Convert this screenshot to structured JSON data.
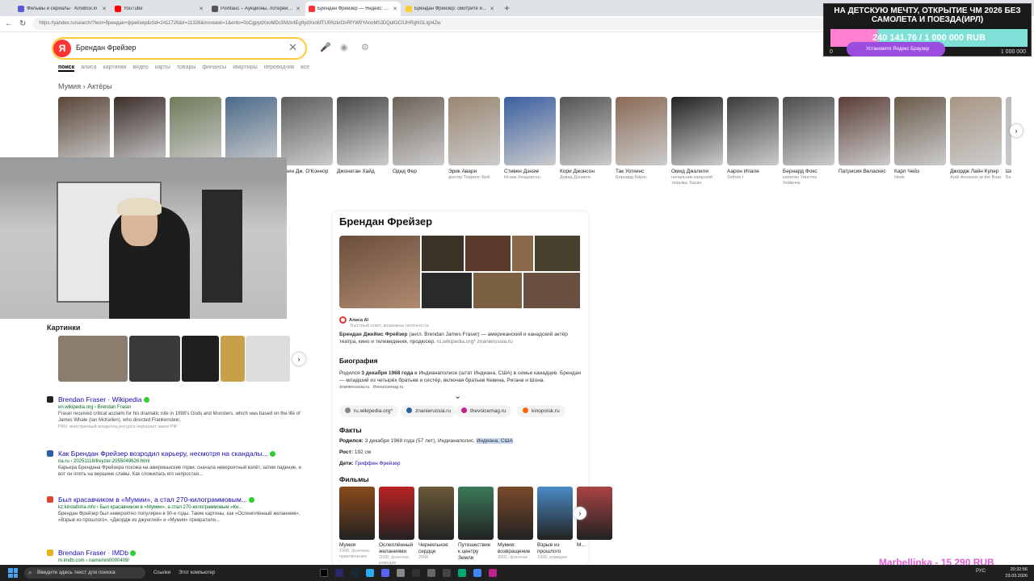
{
  "browser": {
    "tabs": [
      {
        "label": "Фильмы и сериалы · Kinobox.in",
        "color": "#5b5bd6"
      },
      {
        "label": "YouTube",
        "color": "#f00"
      },
      {
        "label": "Pointauc – Аукционы, лотереи и ...",
        "color": "#555"
      },
      {
        "label": "Брендан Фрейзер — Яндекс: нашлось ...",
        "color": "#f33"
      },
      {
        "label": "Брендан Фрейзер: смотрите и ск...",
        "color": "#fc3"
      }
    ],
    "new_tab": "+",
    "url": "https://yandex.ru/search/?text=брендан+фрейзер&clid=2411726&lr=11326&msreask=1&ento=0oCgpydXxoMDc5Mzk4Eg9ydXxoMTU0NzkrOnRlYW0YAnoM0JDQutGC0JHRgNGLIgI4Zw"
  },
  "overlay": {
    "title": "НА ДЕТСКУЮ МЕЧТУ, ОТКРЫТИЕ ЧМ 2026 БЕЗ САМОЛЕТА И ПОЕЗДА(ИРЛ)",
    "progress_text": "240 141.76 / 1 000 000 RUB",
    "progress_fraction": 0.24,
    "min": "0",
    "max": "1 000 000"
  },
  "search": {
    "logo": "Я",
    "query": "Брендан Фрейзер",
    "clear": "✕",
    "promo": "Установите Яндекс Браузер",
    "verticals": [
      "поиск",
      "алиса",
      "картинки",
      "видео",
      "карты",
      "товары",
      "финансы",
      "квартиры",
      "переводчик",
      "все"
    ]
  },
  "breadcrumb": "Мумия › Актёры",
  "actors": [
    {
      "name": "",
      "role": "",
      "color": "#5a4638"
    },
    {
      "name": "",
      "role": "",
      "color": "#3c2e2a"
    },
    {
      "name": "",
      "role": "",
      "color": "#6f7c5a"
    },
    {
      "name": "",
      "role": "",
      "color": "#4b6b8a"
    },
    {
      "name": "...вин Дж. О'Коннор",
      "role": "",
      "color": "#5d5d5d"
    },
    {
      "name": "Джонатан Хайд",
      "role": "",
      "color": "#4a4a4a"
    },
    {
      "name": "Одед Фер",
      "role": "",
      "color": "#6d6258"
    },
    {
      "name": "Эрик Авари",
      "role": "доктор Терренс Бей",
      "color": "#9a8670"
    },
    {
      "name": "Стивен Дэнэм",
      "role": "Исаак Хендерсон",
      "color": "#3a5fa0"
    },
    {
      "name": "Кори Джонсон",
      "role": "Дэвид Дэниелс",
      "color": "#555"
    },
    {
      "name": "Так Уоткинс",
      "role": "Бернард Бёрнс",
      "color": "#8a6a55"
    },
    {
      "name": "Омид Джалили",
      "role": "начальник каирской тюрьмы Хасан",
      "color": "#222"
    },
    {
      "name": "Аарон Ипале",
      "role": "Sethos I",
      "color": "#3b3b3b"
    },
    {
      "name": "Бернард Фокс",
      "role": "капитан Уинстон Хейвлок",
      "color": "#4d4d4d"
    },
    {
      "name": "Патрисия Веласкес",
      "role": "",
      "color": "#5a3d35"
    },
    {
      "name": "Карл Чейз",
      "role": "Hook",
      "color": "#6a5a4a"
    },
    {
      "name": "Джордж Лайн Купер",
      "role": "Arab Assassin at the Boat",
      "color": "#a89684"
    },
    {
      "name": "Шон Кур...",
      "role": "Бензо...",
      "color": "#bbb"
    }
  ],
  "images_block": {
    "title": "Картинки",
    "colors": [
      "#8a7d6e",
      "#3a3a3a",
      "#1e1e1e",
      "#c8a04a",
      "#ddd"
    ]
  },
  "results": [
    {
      "title": "Brendan Fraser · Wikipedia",
      "url": "en.wikipedia.org › Brendan Fraser",
      "snippet": "Fraser received critical acclaim for his dramatic role in 1998's Gods and Monsters, which was based on the life of James Whale (Ian McKellen), who directed Frankenstein.",
      "warn": "РКН: иностранный владелец ресурса нарушает закон РФ",
      "icon": "#222"
    },
    {
      "title": "Как Брендан Фрейзер возродил карьеру, несмотря на скандалы...",
      "url": "ria.ru › 20251116/freyzer-2055049626.html",
      "snippet": "Карьера Брендана Фрейзера похожа на американские горки: сначала невероятный взлёт, затем падение, и вот он опять на вершине славы. Как сложилась его непростая...",
      "warn": "",
      "icon": "#2a5fa8"
    },
    {
      "title": "Был красавчиком в «Мумии», а стал 270-килограммовым...",
      "url": "kz.kinoafisha.info › Был красавчиком в «Мумии», а стал 270-килограммовым «Ки...",
      "snippet": "Брендан Фрейзер был невероятно популярен в 90-е годы. Такие картины, как «Осленплённый желанием», «Взрыв из прошлого», «Джордж из джунглей» и «Мумия» превратили...",
      "warn": "",
      "icon": "#d43"
    },
    {
      "title": "Brendan Fraser · IMDb",
      "url": "m.imdb.com › name/nm0000409/",
      "snippet": "",
      "warn": "",
      "icon": "#e8b21a"
    }
  ],
  "knowledge": {
    "title": "Брендан Фрейзер",
    "photo_colors": [
      "#6a4e3c",
      "#3b3226",
      "#5a3a2a",
      "#8a6a4a",
      "#4a4030",
      "#2a2a2a",
      "#7a6040",
      "#6a5040"
    ],
    "alice": "Алиса AI",
    "alice_sub": "Быстрый ответ, возможны неточности",
    "desc_b": "Брендан Джеймс Фрейзер",
    "desc": " (англ. Brendan James Fraser) — американский и канадский актёр театра, кино и телевидения, продюсер.",
    "desc_src1": "ru.wikipedia.org*",
    "desc_src2": "znanierussia.ru",
    "bio_title": "Биография",
    "bio_pre": "Родился ",
    "bio_b": "3 декабря 1968 года",
    "bio": " в Индианаполисе (штат Индиана, США) в семье канадцев. Брендан — младший из четырёх братьев и сестёр, включая братьев Кевина, Ригана и Шона.",
    "bio_src1": "znanierussia.ru",
    "bio_src2": "thevoicemag.ru",
    "expand": "⌄",
    "chips": [
      {
        "label": "ru.wikipedia.org*",
        "color": "#888"
      },
      {
        "label": "znanierussia.ru",
        "color": "#2a5fa8"
      },
      {
        "label": "thevoicemag.ru",
        "color": "#c0218a"
      },
      {
        "label": "kinopoisk.ru",
        "color": "#f60"
      }
    ],
    "facts_title": "Факты",
    "born_label": "Родился:",
    "born": "3 декабря 1968 года (57 лет), Индианаполис, ",
    "born_hl": "Индиана, США",
    "height_label": "Рост:",
    "height": "192 см",
    "kids_label": "Дети:",
    "kids": "Гриффен Фрейзер",
    "films_title": "Фильмы",
    "films": [
      {
        "name": "Мумия",
        "year": "1999, фэнтези, приключения",
        "color": "#8a4a1a"
      },
      {
        "name": "Ослеплённый желаниями",
        "year": "2000, фэнтези, комедия",
        "color": "#b22"
      },
      {
        "name": "Чернильное сердце",
        "year": "2008",
        "color": "#6a5a3a"
      },
      {
        "name": "Путешествие к центру Земли",
        "year": "",
        "color": "#3a7a5a"
      },
      {
        "name": "Мумия: возвращение",
        "year": "2001, фэнтези",
        "color": "#7a4a2a"
      },
      {
        "name": "Взрыв из прошлого",
        "year": "1999, комедия",
        "color": "#4a8ac8"
      },
      {
        "name": "М...",
        "year": "",
        "color": "#a44"
      }
    ]
  },
  "donation": "Marbellinka - 15 290 RUB",
  "taskbar": {
    "search_placeholder": "Введите здесь текст для поиска",
    "links": "Ссылки",
    "thispc": "Этот компьютер",
    "lang": "РУС",
    "time": "20:32:56",
    "date": "23.03.2026"
  }
}
